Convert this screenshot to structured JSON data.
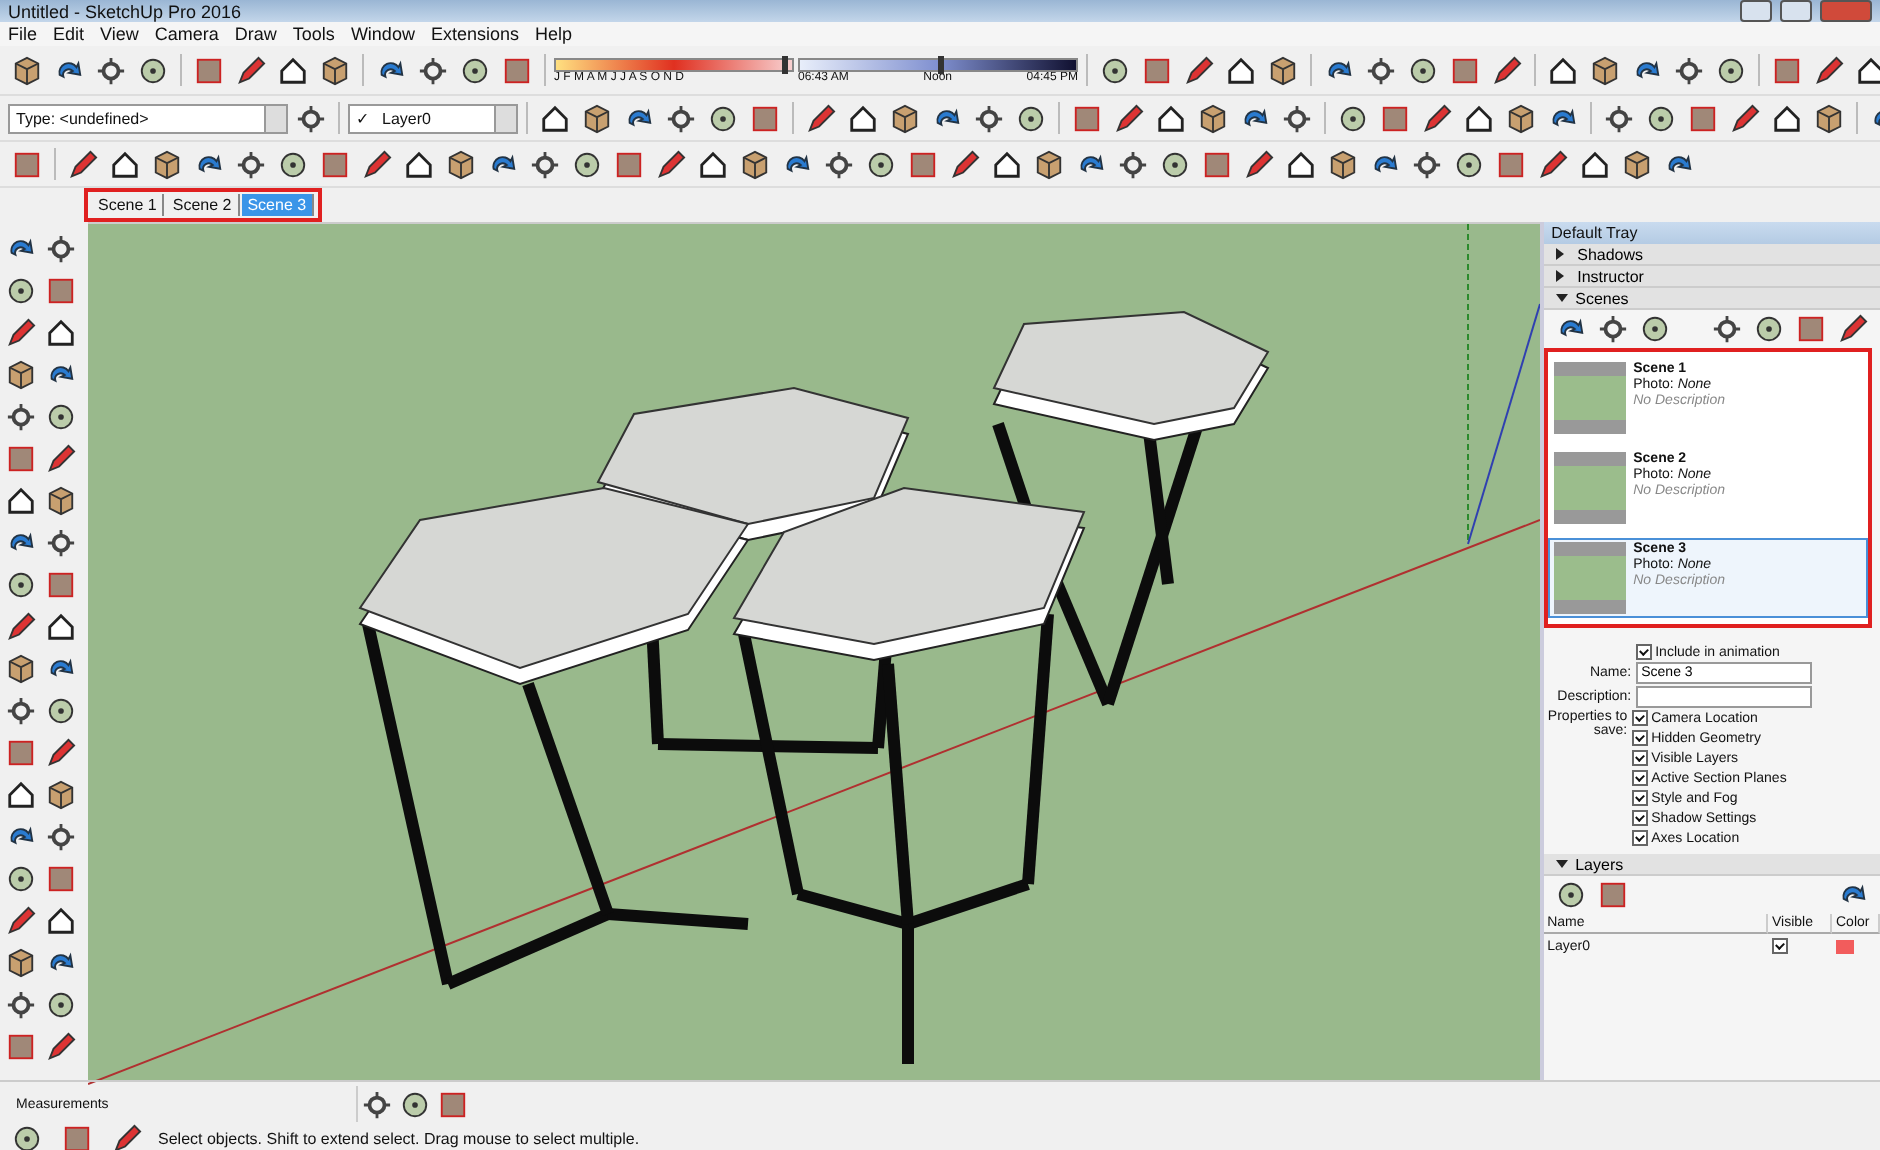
{
  "window": {
    "title": "Untitled - SketchUp Pro 2016"
  },
  "menu": [
    "File",
    "Edit",
    "View",
    "Camera",
    "Draw",
    "Tools",
    "Window",
    "Extensions",
    "Help"
  ],
  "shadow_toolbar": {
    "months": "J F M A M J J A S O N D",
    "date_slider": {
      "level": 0.96
    },
    "time_start": "06:43 AM",
    "time_mid": "Noon",
    "time_end": "04:45 PM",
    "time_slider": {
      "level": 0.5
    }
  },
  "type_dropdown": {
    "value": "Type: <undefined>"
  },
  "layer_dropdown": {
    "check": "✓",
    "value": "Layer0"
  },
  "scene_tabs": [
    {
      "label": "Scene 1",
      "selected": false
    },
    {
      "label": "Scene 2",
      "selected": false
    },
    {
      "label": "Scene 3",
      "selected": true
    }
  ],
  "tray": {
    "title": "Default Tray",
    "panels": [
      {
        "title": "Shadows",
        "expanded": false
      },
      {
        "title": "Instructor",
        "expanded": false
      },
      {
        "title": "Scenes",
        "expanded": true
      }
    ],
    "scenes": [
      {
        "name": "Scene 1",
        "photo_label": "Photo:",
        "photo": "None",
        "description": "No Description",
        "selected": false
      },
      {
        "name": "Scene 2",
        "photo_label": "Photo:",
        "photo": "None",
        "description": "No Description",
        "selected": false
      },
      {
        "name": "Scene 3",
        "photo_label": "Photo:",
        "photo": "None",
        "description": "No Description",
        "selected": true
      }
    ],
    "include_in_animation": {
      "label": "Include in animation",
      "checked": true
    },
    "name_field": {
      "label": "Name:",
      "value": "Scene 3"
    },
    "description_field": {
      "label": "Description:"
    },
    "properties_label": "Properties to save:",
    "properties": [
      {
        "label": "Camera Location",
        "checked": true
      },
      {
        "label": "Hidden Geometry",
        "checked": true
      },
      {
        "label": "Visible Layers",
        "checked": true
      },
      {
        "label": "Active Section Planes",
        "checked": true
      },
      {
        "label": "Style and Fog",
        "checked": true
      },
      {
        "label": "Shadow Settings",
        "checked": true
      },
      {
        "label": "Axes Location",
        "checked": true
      }
    ],
    "layers": {
      "title": "Layers",
      "expanded": true,
      "columns": [
        "Name",
        "Visible",
        "Color"
      ],
      "rows": [
        {
          "name": "Layer0",
          "visible": true,
          "color": "#f25c5c"
        }
      ]
    }
  },
  "measurements_label": "Measurements",
  "status": "Select objects. Shift to extend select. Drag mouse to select multiple."
}
